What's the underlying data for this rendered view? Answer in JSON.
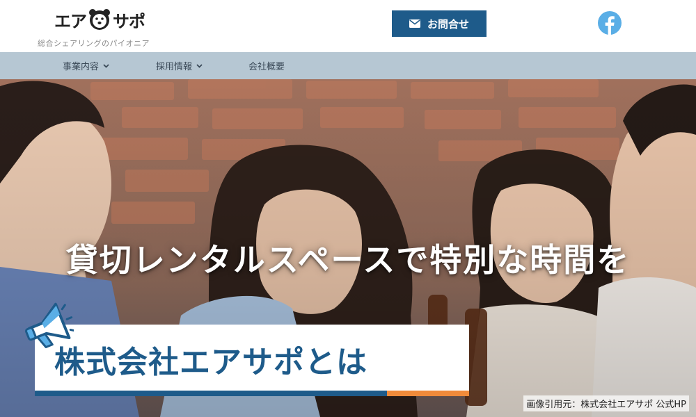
{
  "header": {
    "logo_left": "エア",
    "logo_right": "サポ",
    "tagline": "総合シェアリングのパイオニア",
    "contact_label": "お問合せ",
    "brand_color": "#1e5b8a",
    "facebook_color": "#5aaee6"
  },
  "nav": {
    "items": [
      {
        "label": "事業内容"
      },
      {
        "label": "採用情報"
      },
      {
        "label": "会社概要"
      }
    ],
    "background": "#b6c7d3"
  },
  "hero": {
    "headline": "貸切レンタルスペースで特別な時間を",
    "title": "株式会社エアサポとは",
    "accent_blue": "#1e5b8a",
    "accent_orange": "#f08b3a",
    "credit": "画像引用元：株式会社エアサポ 公式HP"
  }
}
